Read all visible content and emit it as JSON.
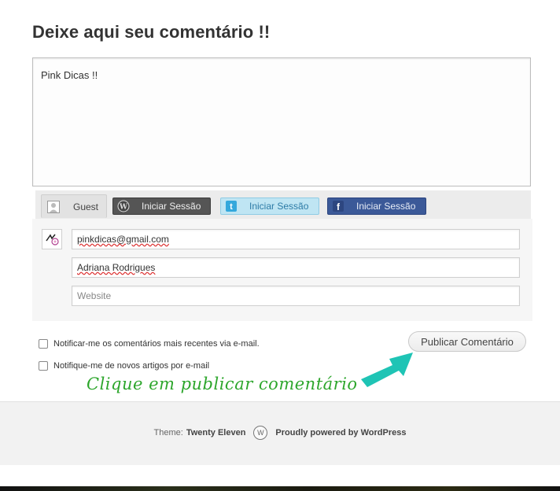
{
  "heading": "Deixe aqui seu comentário !!",
  "comment": {
    "text": "Pink Dicas !!"
  },
  "login_tabs": {
    "guest": "Guest",
    "wordpress": "Iniciar Sessão",
    "twitter": "Iniciar Sessão",
    "facebook": "Iniciar Sessão"
  },
  "fields": {
    "email_value": "pinkdicas@gmail.com",
    "name_value": "Adriana Rodrigues",
    "website_placeholder": "Website"
  },
  "checkboxes": {
    "notify_comments": "Notificar-me os comentários mais recentes via e-mail.",
    "notify_posts": "Notifique-me de novos artigos por e-mail"
  },
  "submit_label": "Publicar Comentário",
  "annotation": "Clique em publicar comentário",
  "footer": {
    "theme_prefix": "Theme:",
    "theme_name": "Twenty Eleven",
    "powered": "Proudly powered by WordPress"
  },
  "colors": {
    "annotation_green": "#2da62c",
    "arrow_teal": "#1fc4b5",
    "facebook_blue": "#3b5998",
    "twitter_blue": "#bfe5f3"
  },
  "icons": [
    "guest-avatar-icon",
    "wordpress-icon",
    "twitter-icon",
    "facebook-icon",
    "wordpress-logo-icon"
  ]
}
